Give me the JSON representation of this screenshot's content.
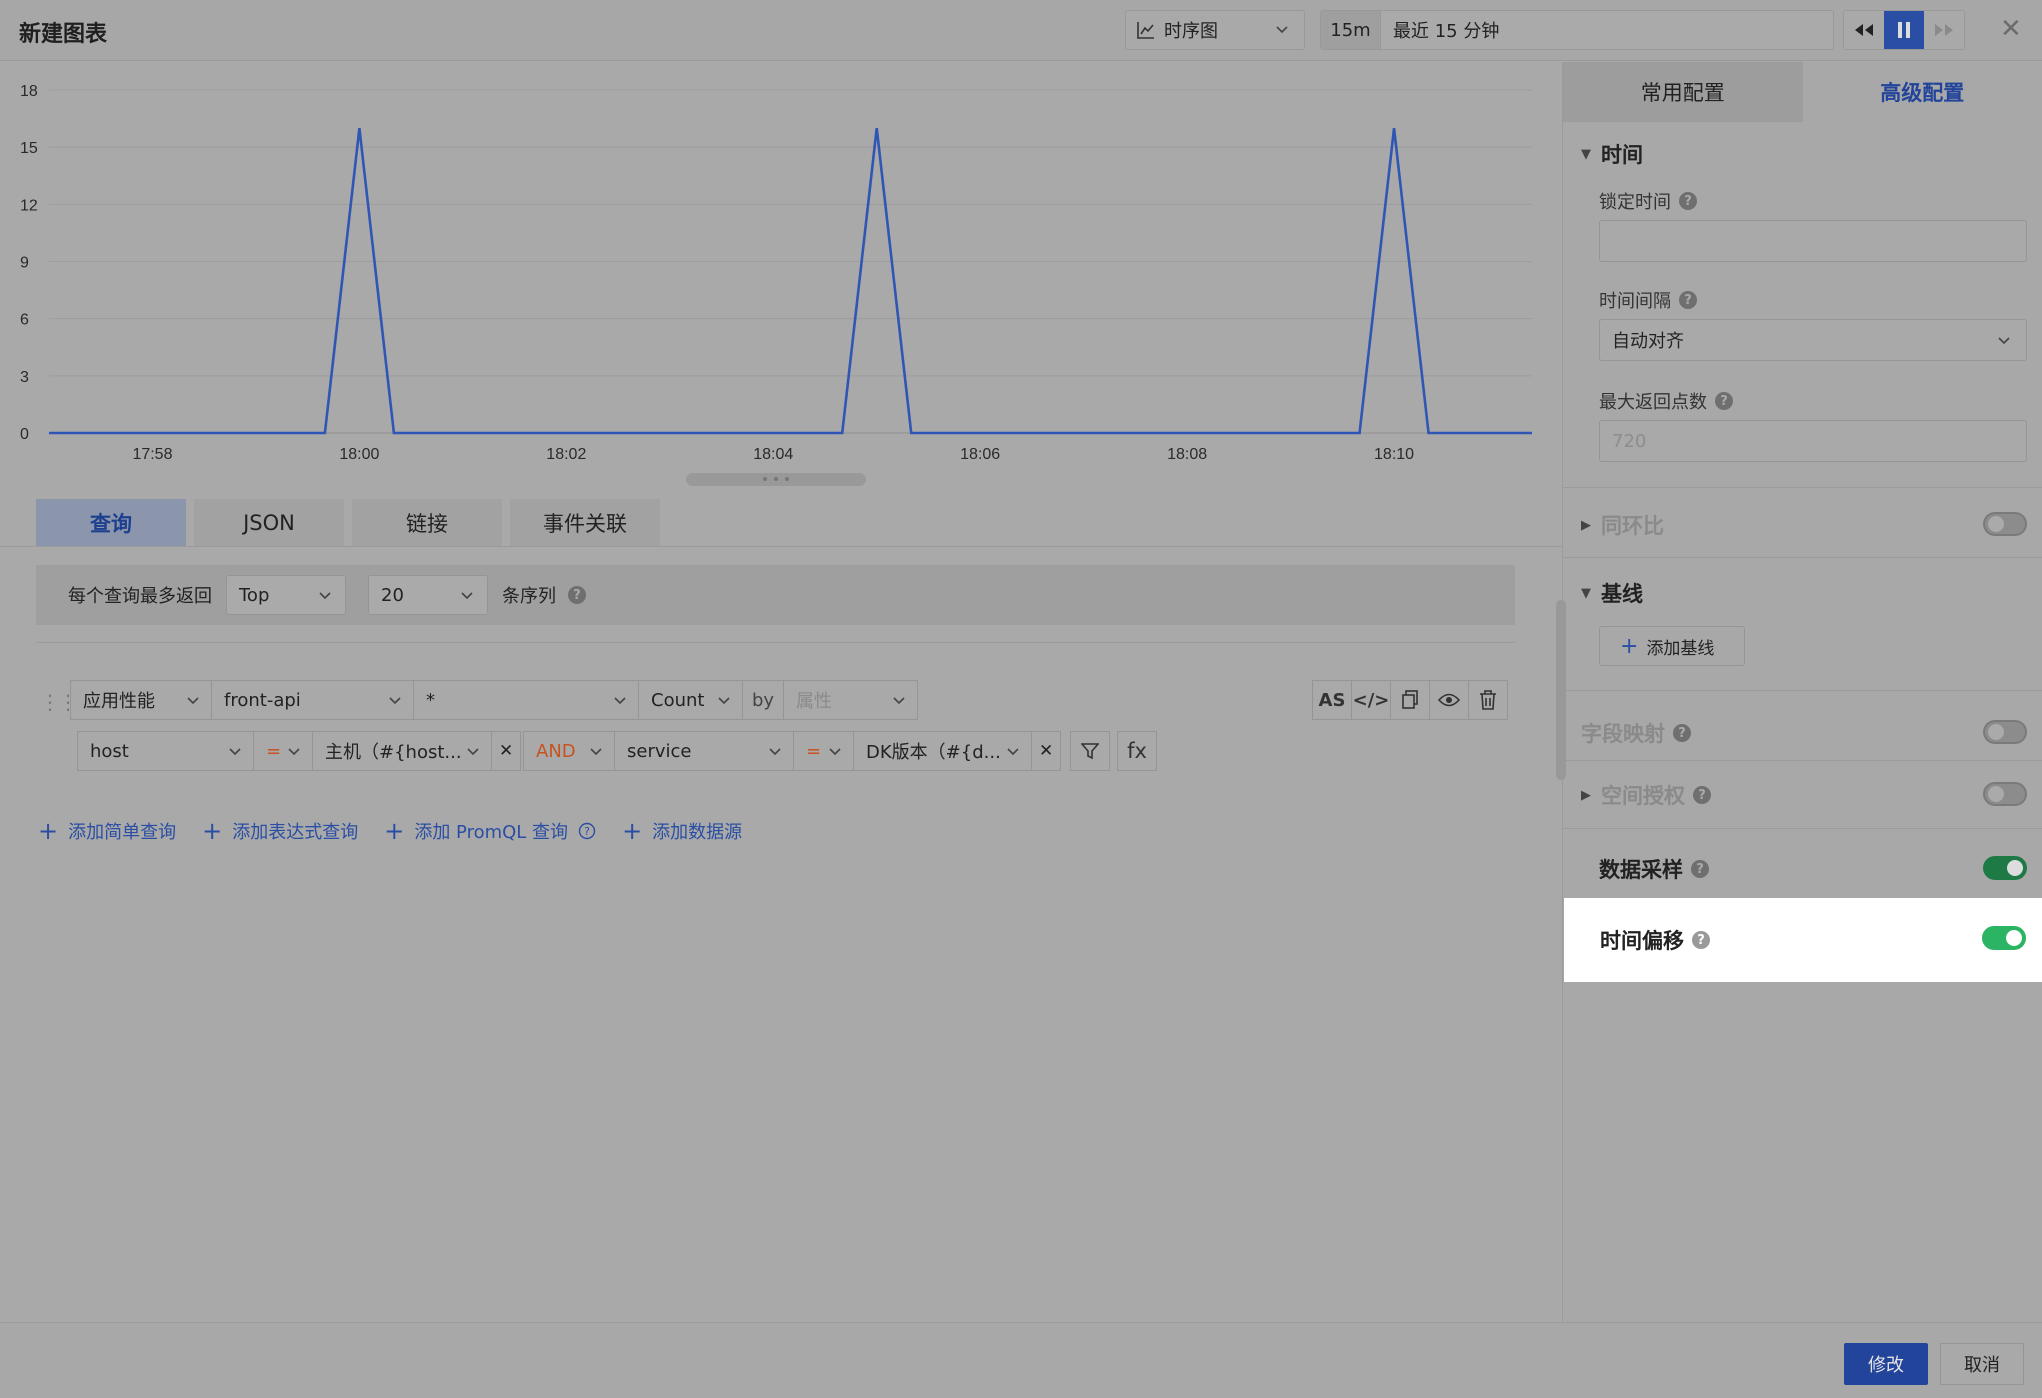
{
  "header": {
    "title": "新建图表",
    "chart_type": "时序图",
    "time_short": "15m",
    "time_label": "最近 15 分钟"
  },
  "chart_data": {
    "type": "line",
    "x_ticks": [
      "17:58",
      "18:00",
      "18:02",
      "18:04",
      "18:06",
      "18:08",
      "18:10"
    ],
    "y_ticks": [
      0,
      3,
      6,
      9,
      12,
      15,
      18
    ],
    "ylim": [
      0,
      18
    ],
    "series": [
      {
        "color": "#2f56b5",
        "x": [
          "17:57",
          "17:58",
          "17:59",
          "17:59:40",
          "18:00",
          "18:00:20",
          "18:01",
          "18:02",
          "18:03",
          "18:04",
          "18:04:40",
          "18:05",
          "18:05:20",
          "18:06",
          "18:07",
          "18:08",
          "18:09",
          "18:09:40",
          "18:10",
          "18:10:20",
          "18:11",
          "18:11:20"
        ],
        "values": [
          0,
          0,
          0,
          0,
          16,
          0,
          0,
          0,
          0,
          0,
          0,
          16,
          0,
          0,
          0,
          0,
          0,
          0,
          16,
          0,
          0,
          0
        ]
      }
    ]
  },
  "tabs": [
    "查询",
    "JSON",
    "链接",
    "事件关联"
  ],
  "topn": {
    "label": "每个查询最多返回",
    "mode": "Top",
    "count": "20",
    "suffix": "条序列"
  },
  "query": {
    "source": "应用性能",
    "service": "front-api",
    "field": "*",
    "agg": "Count",
    "by": "by",
    "by_placeholder": "属性",
    "actions": [
      "AS",
      "</>",
      "copy",
      "eye",
      "trash"
    ],
    "filter1_key": "host",
    "filter1_op": "=",
    "filter1_val": "主机（#{host...",
    "logic": "AND",
    "filter2_key": "service",
    "filter2_op": "=",
    "filter2_val": "DK版本（#{d...",
    "fx": "fx"
  },
  "add_links": [
    "添加简单查询",
    "添加表达式查询",
    "添加 PromQL 查询",
    "添加数据源"
  ],
  "side": {
    "tab_common": "常用配置",
    "tab_advanced": "高级配置",
    "sec_time": "时间",
    "lock_time": "锁定时间",
    "interval": "时间间隔",
    "interval_value": "自动对齐",
    "max_points": "最大返回点数",
    "max_points_placeholder": "720",
    "compare": "同环比",
    "baseline": "基线",
    "add_baseline": "添加基线",
    "field_mapping": "字段映射",
    "space_auth": "空间授权",
    "sampling": "数据采样",
    "time_offset": "时间偏移"
  },
  "footer": {
    "confirm": "修改",
    "cancel": "取消"
  }
}
